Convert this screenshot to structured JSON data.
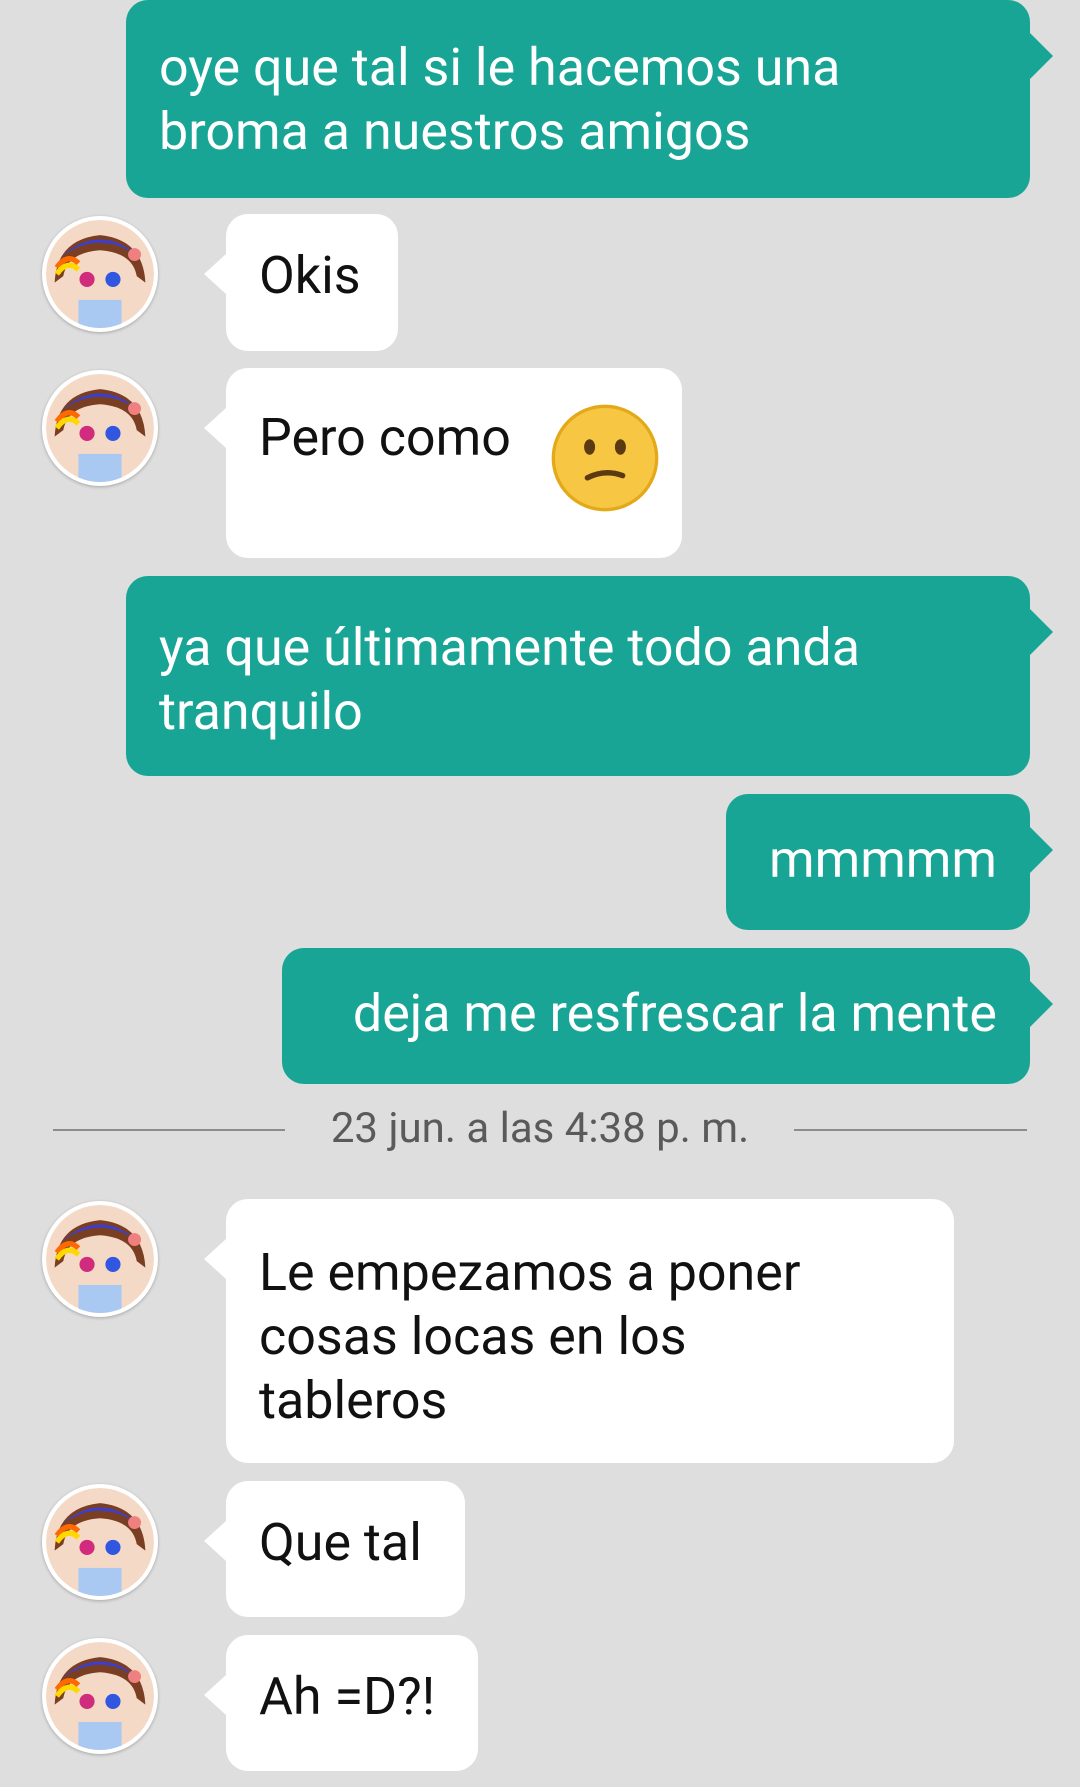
{
  "messages": [
    {
      "id": "m1",
      "side": "out",
      "text": "oye que tal si le hacemos una\nbroma a nuestros amigos"
    },
    {
      "id": "m2",
      "side": "in",
      "text": "Okis"
    },
    {
      "id": "m3",
      "side": "in",
      "text": "Pero como",
      "emoji": "confused-face-emoji"
    },
    {
      "id": "m4",
      "side": "out",
      "text": "ya que últimamente todo anda\ntranquilo"
    },
    {
      "id": "m5",
      "side": "out",
      "text": "mmmmm"
    },
    {
      "id": "m6",
      "side": "out",
      "text": "deja me resfrescar la mente"
    },
    {
      "id": "m7",
      "side": "in",
      "text": "Le empezamos a poner\ncosas locas en los\ntableros"
    },
    {
      "id": "m8",
      "side": "in",
      "text": "Que tal"
    },
    {
      "id": "m9",
      "side": "in",
      "text": "Ah =D?!"
    }
  ],
  "divider": {
    "label": "23 jun. a las 4:38 p. m."
  },
  "colors": {
    "outgoing_bubble": "#19a596",
    "incoming_bubble": "#ffffff",
    "background": "#dedede"
  }
}
